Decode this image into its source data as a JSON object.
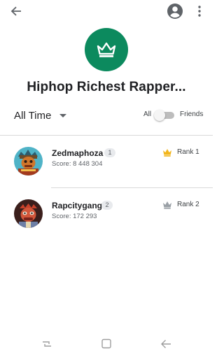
{
  "header": {
    "back_icon": "arrow-back-icon",
    "account_icon": "account-circle-icon",
    "more_icon": "more-vert-icon"
  },
  "game": {
    "icon": "crown-icon",
    "icon_color": "#0c8a5e",
    "title": "Hiphop Richest Rapper..."
  },
  "filters": {
    "time_range": "All Time",
    "toggle_left": "All",
    "toggle_right": "Friends",
    "toggle_state": "All"
  },
  "leaderboard": [
    {
      "name": "Zedmaphoza",
      "level": "1",
      "score": "Score: 8 448 304",
      "rank": "Rank 1",
      "crown_color": "#f2b51b"
    },
    {
      "name": "Rapcitygang",
      "level": "2",
      "score": "Score: 172 293",
      "rank": "Rank 2",
      "crown_color": "#9aa0a6"
    }
  ],
  "system_nav": {
    "recents_icon": "recents-icon",
    "home_icon": "home-square-icon",
    "back_icon": "nav-back-icon"
  }
}
